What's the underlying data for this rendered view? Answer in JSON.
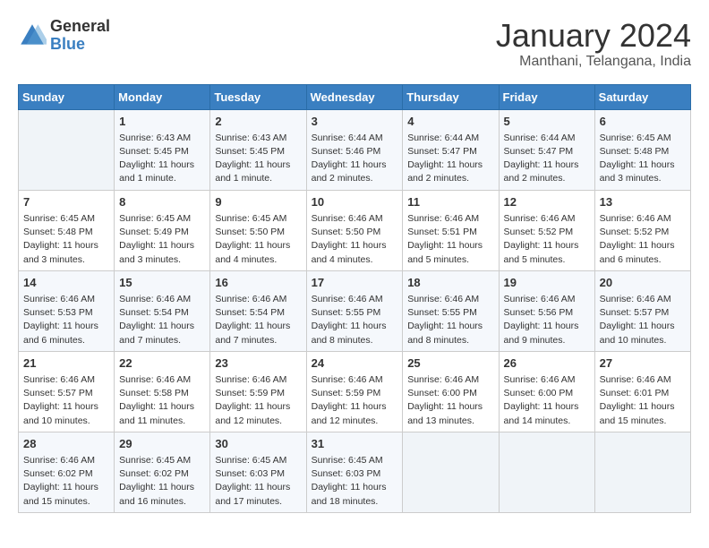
{
  "logo": {
    "general": "General",
    "blue": "Blue"
  },
  "title": "January 2024",
  "subtitle": "Manthani, Telangana, India",
  "headers": [
    "Sunday",
    "Monday",
    "Tuesday",
    "Wednesday",
    "Thursday",
    "Friday",
    "Saturday"
  ],
  "weeks": [
    [
      {
        "day": "",
        "info": ""
      },
      {
        "day": "1",
        "info": "Sunrise: 6:43 AM\nSunset: 5:45 PM\nDaylight: 11 hours and 1 minute."
      },
      {
        "day": "2",
        "info": "Sunrise: 6:43 AM\nSunset: 5:45 PM\nDaylight: 11 hours and 1 minute."
      },
      {
        "day": "3",
        "info": "Sunrise: 6:44 AM\nSunset: 5:46 PM\nDaylight: 11 hours and 2 minutes."
      },
      {
        "day": "4",
        "info": "Sunrise: 6:44 AM\nSunset: 5:47 PM\nDaylight: 11 hours and 2 minutes."
      },
      {
        "day": "5",
        "info": "Sunrise: 6:44 AM\nSunset: 5:47 PM\nDaylight: 11 hours and 2 minutes."
      },
      {
        "day": "6",
        "info": "Sunrise: 6:45 AM\nSunset: 5:48 PM\nDaylight: 11 hours and 3 minutes."
      }
    ],
    [
      {
        "day": "7",
        "info": "Sunrise: 6:45 AM\nSunset: 5:48 PM\nDaylight: 11 hours and 3 minutes."
      },
      {
        "day": "8",
        "info": "Sunrise: 6:45 AM\nSunset: 5:49 PM\nDaylight: 11 hours and 3 minutes."
      },
      {
        "day": "9",
        "info": "Sunrise: 6:45 AM\nSunset: 5:50 PM\nDaylight: 11 hours and 4 minutes."
      },
      {
        "day": "10",
        "info": "Sunrise: 6:46 AM\nSunset: 5:50 PM\nDaylight: 11 hours and 4 minutes."
      },
      {
        "day": "11",
        "info": "Sunrise: 6:46 AM\nSunset: 5:51 PM\nDaylight: 11 hours and 5 minutes."
      },
      {
        "day": "12",
        "info": "Sunrise: 6:46 AM\nSunset: 5:52 PM\nDaylight: 11 hours and 5 minutes."
      },
      {
        "day": "13",
        "info": "Sunrise: 6:46 AM\nSunset: 5:52 PM\nDaylight: 11 hours and 6 minutes."
      }
    ],
    [
      {
        "day": "14",
        "info": "Sunrise: 6:46 AM\nSunset: 5:53 PM\nDaylight: 11 hours and 6 minutes."
      },
      {
        "day": "15",
        "info": "Sunrise: 6:46 AM\nSunset: 5:54 PM\nDaylight: 11 hours and 7 minutes."
      },
      {
        "day": "16",
        "info": "Sunrise: 6:46 AM\nSunset: 5:54 PM\nDaylight: 11 hours and 7 minutes."
      },
      {
        "day": "17",
        "info": "Sunrise: 6:46 AM\nSunset: 5:55 PM\nDaylight: 11 hours and 8 minutes."
      },
      {
        "day": "18",
        "info": "Sunrise: 6:46 AM\nSunset: 5:55 PM\nDaylight: 11 hours and 8 minutes."
      },
      {
        "day": "19",
        "info": "Sunrise: 6:46 AM\nSunset: 5:56 PM\nDaylight: 11 hours and 9 minutes."
      },
      {
        "day": "20",
        "info": "Sunrise: 6:46 AM\nSunset: 5:57 PM\nDaylight: 11 hours and 10 minutes."
      }
    ],
    [
      {
        "day": "21",
        "info": "Sunrise: 6:46 AM\nSunset: 5:57 PM\nDaylight: 11 hours and 10 minutes."
      },
      {
        "day": "22",
        "info": "Sunrise: 6:46 AM\nSunset: 5:58 PM\nDaylight: 11 hours and 11 minutes."
      },
      {
        "day": "23",
        "info": "Sunrise: 6:46 AM\nSunset: 5:59 PM\nDaylight: 11 hours and 12 minutes."
      },
      {
        "day": "24",
        "info": "Sunrise: 6:46 AM\nSunset: 5:59 PM\nDaylight: 11 hours and 12 minutes."
      },
      {
        "day": "25",
        "info": "Sunrise: 6:46 AM\nSunset: 6:00 PM\nDaylight: 11 hours and 13 minutes."
      },
      {
        "day": "26",
        "info": "Sunrise: 6:46 AM\nSunset: 6:00 PM\nDaylight: 11 hours and 14 minutes."
      },
      {
        "day": "27",
        "info": "Sunrise: 6:46 AM\nSunset: 6:01 PM\nDaylight: 11 hours and 15 minutes."
      }
    ],
    [
      {
        "day": "28",
        "info": "Sunrise: 6:46 AM\nSunset: 6:02 PM\nDaylight: 11 hours and 15 minutes."
      },
      {
        "day": "29",
        "info": "Sunrise: 6:45 AM\nSunset: 6:02 PM\nDaylight: 11 hours and 16 minutes."
      },
      {
        "day": "30",
        "info": "Sunrise: 6:45 AM\nSunset: 6:03 PM\nDaylight: 11 hours and 17 minutes."
      },
      {
        "day": "31",
        "info": "Sunrise: 6:45 AM\nSunset: 6:03 PM\nDaylight: 11 hours and 18 minutes."
      },
      {
        "day": "",
        "info": ""
      },
      {
        "day": "",
        "info": ""
      },
      {
        "day": "",
        "info": ""
      }
    ]
  ]
}
